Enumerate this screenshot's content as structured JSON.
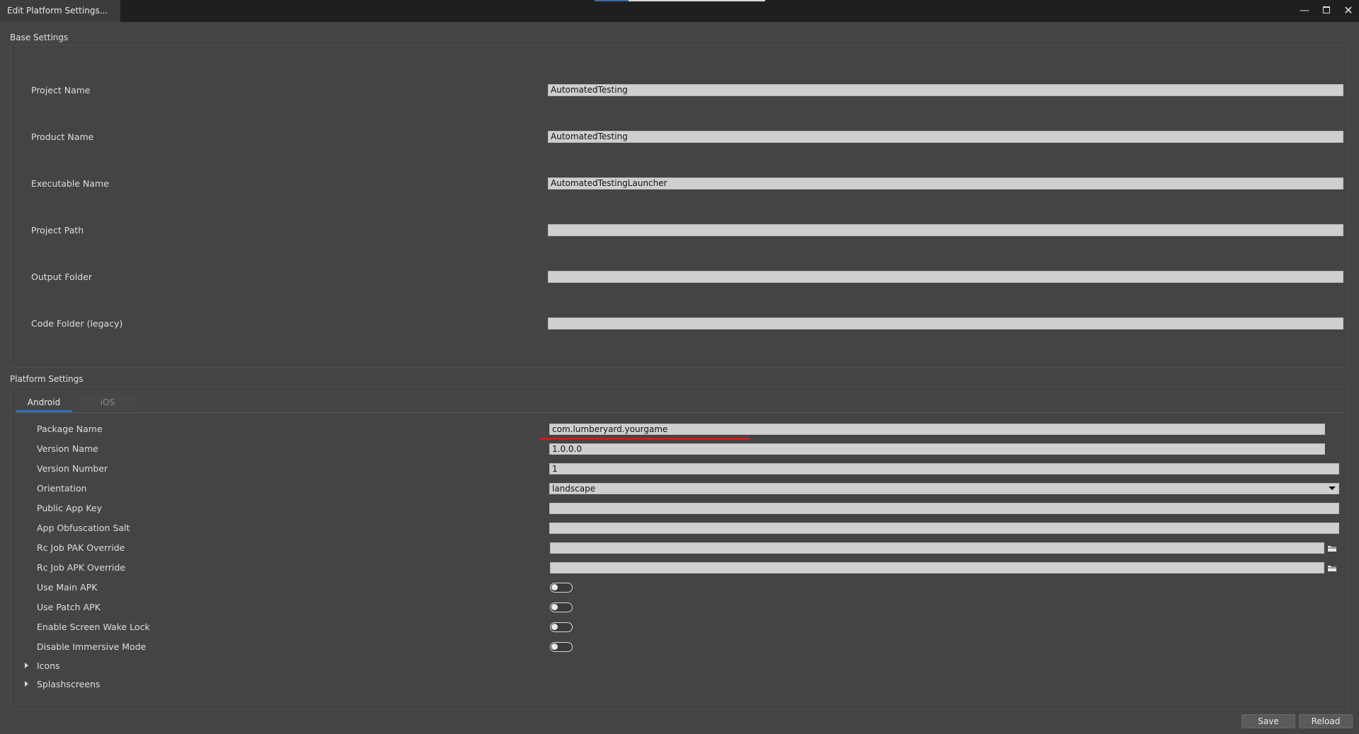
{
  "window": {
    "title": "Edit Platform Settings...",
    "minimize_glyph": "—",
    "close_glyph": "✕"
  },
  "base_settings": {
    "title": "Base Settings",
    "fields": [
      {
        "label": "Project Name",
        "value": "AutomatedTesting"
      },
      {
        "label": "Product Name",
        "value": "AutomatedTesting"
      },
      {
        "label": "Executable Name",
        "value": "AutomatedTestingLauncher"
      },
      {
        "label": "Project Path",
        "value": ""
      },
      {
        "label": "Output Folder",
        "value": ""
      },
      {
        "label": "Code Folder (legacy)",
        "value": ""
      }
    ]
  },
  "platform_settings": {
    "title": "Platform Settings",
    "tabs": [
      {
        "label": "Android",
        "active": true
      },
      {
        "label": "iOS",
        "active": false
      }
    ],
    "fields": {
      "package_name": {
        "label": "Package Name",
        "value": "com.lumberyard.yourgame"
      },
      "version_name": {
        "label": "Version Name",
        "value": "1.0.0.0"
      },
      "version_number": {
        "label": "Version Number",
        "value": "1"
      },
      "orientation": {
        "label": "Orientation",
        "value": "landscape"
      },
      "public_app_key": {
        "label": "Public App Key",
        "value": ""
      },
      "app_obfuscation_salt": {
        "label": "App Obfuscation Salt",
        "value": ""
      },
      "rc_job_pak_override": {
        "label": "Rc Job PAK Override",
        "value": ""
      },
      "rc_job_apk_override": {
        "label": "Rc Job APK Override",
        "value": ""
      }
    },
    "toggles": [
      {
        "label": "Use Main APK",
        "on": false
      },
      {
        "label": "Use Patch APK",
        "on": false
      },
      {
        "label": "Enable Screen Wake Lock",
        "on": false
      },
      {
        "label": "Disable Immersive Mode",
        "on": false
      }
    ],
    "expanders": [
      {
        "label": "Icons"
      },
      {
        "label": "Splashscreens"
      }
    ]
  },
  "buttons": {
    "save": "Save",
    "reload": "Reload"
  },
  "colors": {
    "background": "#444444",
    "titlebar": "#1f1f1f",
    "field": "#cfcfcf",
    "accent": "#2f6fba",
    "annotation_underline": "#d11a1a"
  },
  "icons": [
    "minimize-icon",
    "maximize-icon",
    "close-icon",
    "folder-icon",
    "expand-triangle-icon",
    "dropdown-arrow-icon"
  ]
}
